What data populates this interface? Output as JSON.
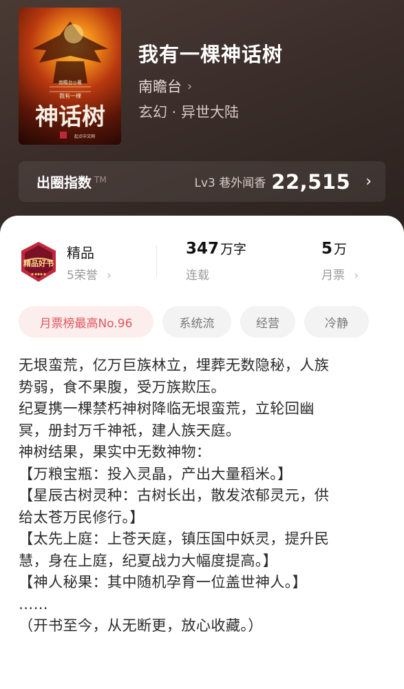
{
  "book": {
    "title": "我有一棵神话树",
    "author": "南瞻台",
    "author_chevron": "›",
    "genre": "玄幻 · 异世大陆",
    "cover": {
      "title_text": "神话树",
      "small_text": "我有一棵",
      "author_text": "南瞻台◎著",
      "publisher_text": "起点中文网"
    }
  },
  "index_bar": {
    "label": "出圈指数",
    "tm": "TM",
    "level": "Lv3 巷外闻香",
    "value": "22,515",
    "chevron": "›"
  },
  "stats": {
    "honor": {
      "title": "精品",
      "sub": "5荣誉",
      "chevron": "›",
      "badge_text": "精品好书"
    },
    "words": {
      "number": "347",
      "unit": "万字",
      "sub": "连载"
    },
    "tickets": {
      "number": "5",
      "unit": "万",
      "sub": "月票",
      "chevron": "›"
    }
  },
  "tags": [
    "月票榜最高No.96",
    "系统流",
    "经营",
    "冷静"
  ],
  "synopsis": [
    "无垠蛮荒，亿万巨族林立，埋葬无数隐秘，人族",
    "势弱，食不果腹，受万族欺压。",
    "纪夏携一棵禁朽神树降临无垠蛮荒，立轮回幽",
    "冥，册封万千神祇，建人族天庭。",
    "神树结果，果实中无数神物：",
    "【万粮宝瓶：投入灵晶，产出大量稻米。】",
    "【星辰古树灵种：古树长出，散发浓郁灵元，供",
    "给太苍万民修行。】",
    "【太先上庭：上苍天庭，镇压国中妖灵，提升民",
    "慧，身在上庭，纪夏战力大幅度提高。】",
    "【神人秘果：其中随机孕育一位盖世神人。】",
    "……",
    "（开书至今，从无断更，放心收藏。）"
  ],
  "colors": {
    "hero_bg": "#3b2e2a",
    "accent_red": "#e0555c",
    "badge_red": "#c0283a"
  }
}
